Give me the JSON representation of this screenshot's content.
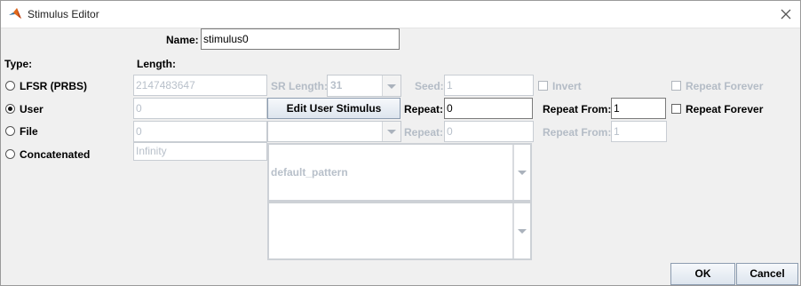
{
  "window": {
    "title": "Stimulus Editor"
  },
  "name_field": {
    "label": "Name:",
    "value": "stimulus0"
  },
  "headers": {
    "type": "Type:",
    "length": "Length:"
  },
  "rows": {
    "lfsr": {
      "radio_label": "LFSR (PRBS)",
      "selected": false,
      "length": "2147483647",
      "sr_length_label": "SR Length:",
      "sr_length_value": "31",
      "seed_label": "Seed:",
      "seed_value": "1",
      "invert_label": "Invert",
      "invert_checked": false,
      "repeat_forever_label": "Repeat Forever",
      "repeat_forever_checked": false
    },
    "user": {
      "radio_label": "User",
      "selected": true,
      "length": "0",
      "edit_button": "Edit User Stimulus",
      "repeat_label": "Repeat:",
      "repeat_value": "0",
      "repeat_from_label": "Repeat From:",
      "repeat_from_value": "1",
      "repeat_forever_label": "Repeat Forever",
      "repeat_forever_checked": false
    },
    "file": {
      "radio_label": "File",
      "selected": false,
      "length": "0",
      "file_value": "",
      "repeat_label": "Repeat:",
      "repeat_value": "0",
      "repeat_from_label": "Repeat From:",
      "repeat_from_value": "1"
    },
    "concatenated": {
      "radio_label": "Concatenated",
      "selected": false,
      "length": "Infinity",
      "list1_value": "default_pattern",
      "list2_value": ""
    }
  },
  "buttons": {
    "ok": "OK",
    "cancel": "Cancel"
  },
  "icons": {
    "app": "matlab-logo-icon",
    "close": "close-icon"
  }
}
